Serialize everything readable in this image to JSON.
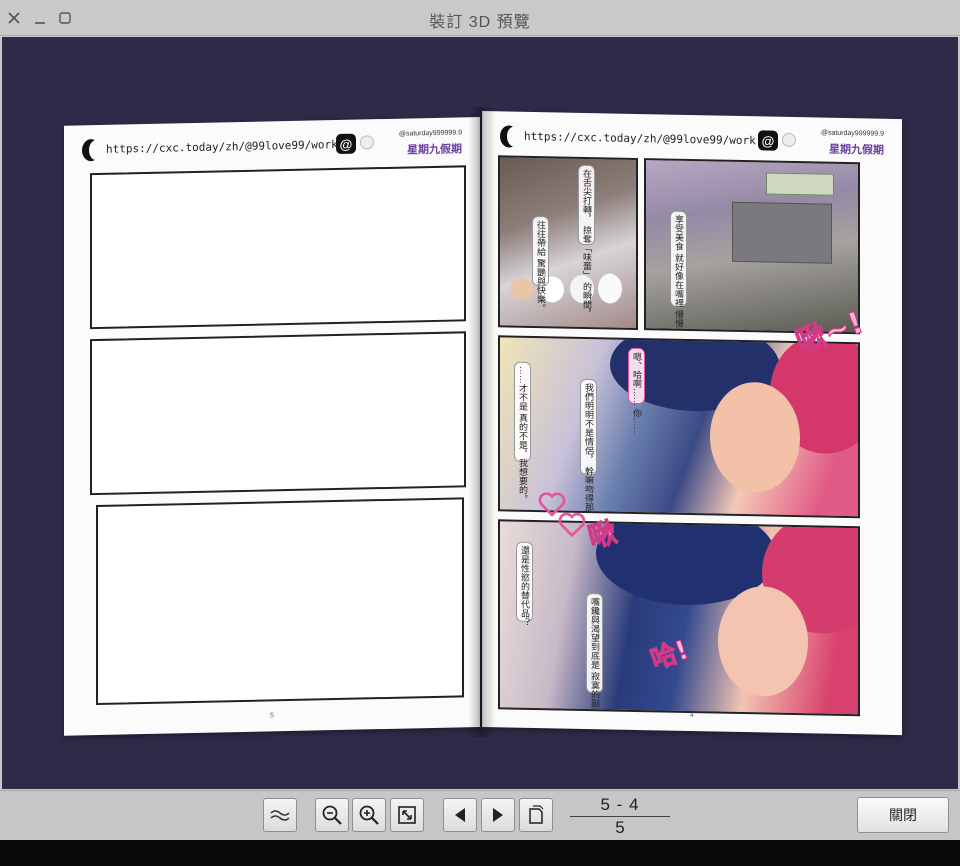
{
  "window": {
    "title": "裝訂 3D 預覽",
    "controls": [
      "close-icon",
      "minimize-icon",
      "maximize-icon"
    ]
  },
  "book": {
    "left_page": {
      "header_url": "https://cxc.today/zh/@99love99/work",
      "header_handle": "@saturday999999.9",
      "header_brand": "星期九假期",
      "page_number": "5"
    },
    "right_page": {
      "header_url": "https://cxc.today/zh/@99love99/work",
      "header_handle": "@saturday999999.9",
      "header_brand": "星期九假期",
      "page_number": "4",
      "bubbles": {
        "b1": "在舌尖打轉，\n掠奪「味蕾」\n的瞬間，",
        "b2": "往往帶給\n驚艷與快樂。",
        "b3": "享受美食\n就好像在嘴裡\n慢慢發酵的喜歡。",
        "b4": "嗯、哈啊……\n你……",
        "b5": "我們明明不是情侶，\n幹嘛吻得那麼過分？",
        "b6": "……才不是\n真的不是，我想要的。",
        "b7": "還是性慾的替代品？",
        "b8": "嘴饞與渴望到底是\n寂寞的副作物，"
      },
      "sfx": {
        "s1": "啾~!",
        "s2": "啾",
        "s3": "哈!"
      }
    }
  },
  "toolbar": {
    "buttons": [
      "wave-view-icon",
      "zoom-out-icon",
      "zoom-in-icon",
      "fit-view-icon",
      "prev-page-icon",
      "next-page-icon",
      "page-single-icon"
    ],
    "page_current": "5 - 4",
    "page_total": "5",
    "close_label": "關閉"
  },
  "colors": {
    "viewport_bg": "#2d2b48",
    "chrome_bg": "#c6c6c6",
    "brand_purple": "#6a3fa0",
    "sfx_pink": "#ffb2d4"
  }
}
